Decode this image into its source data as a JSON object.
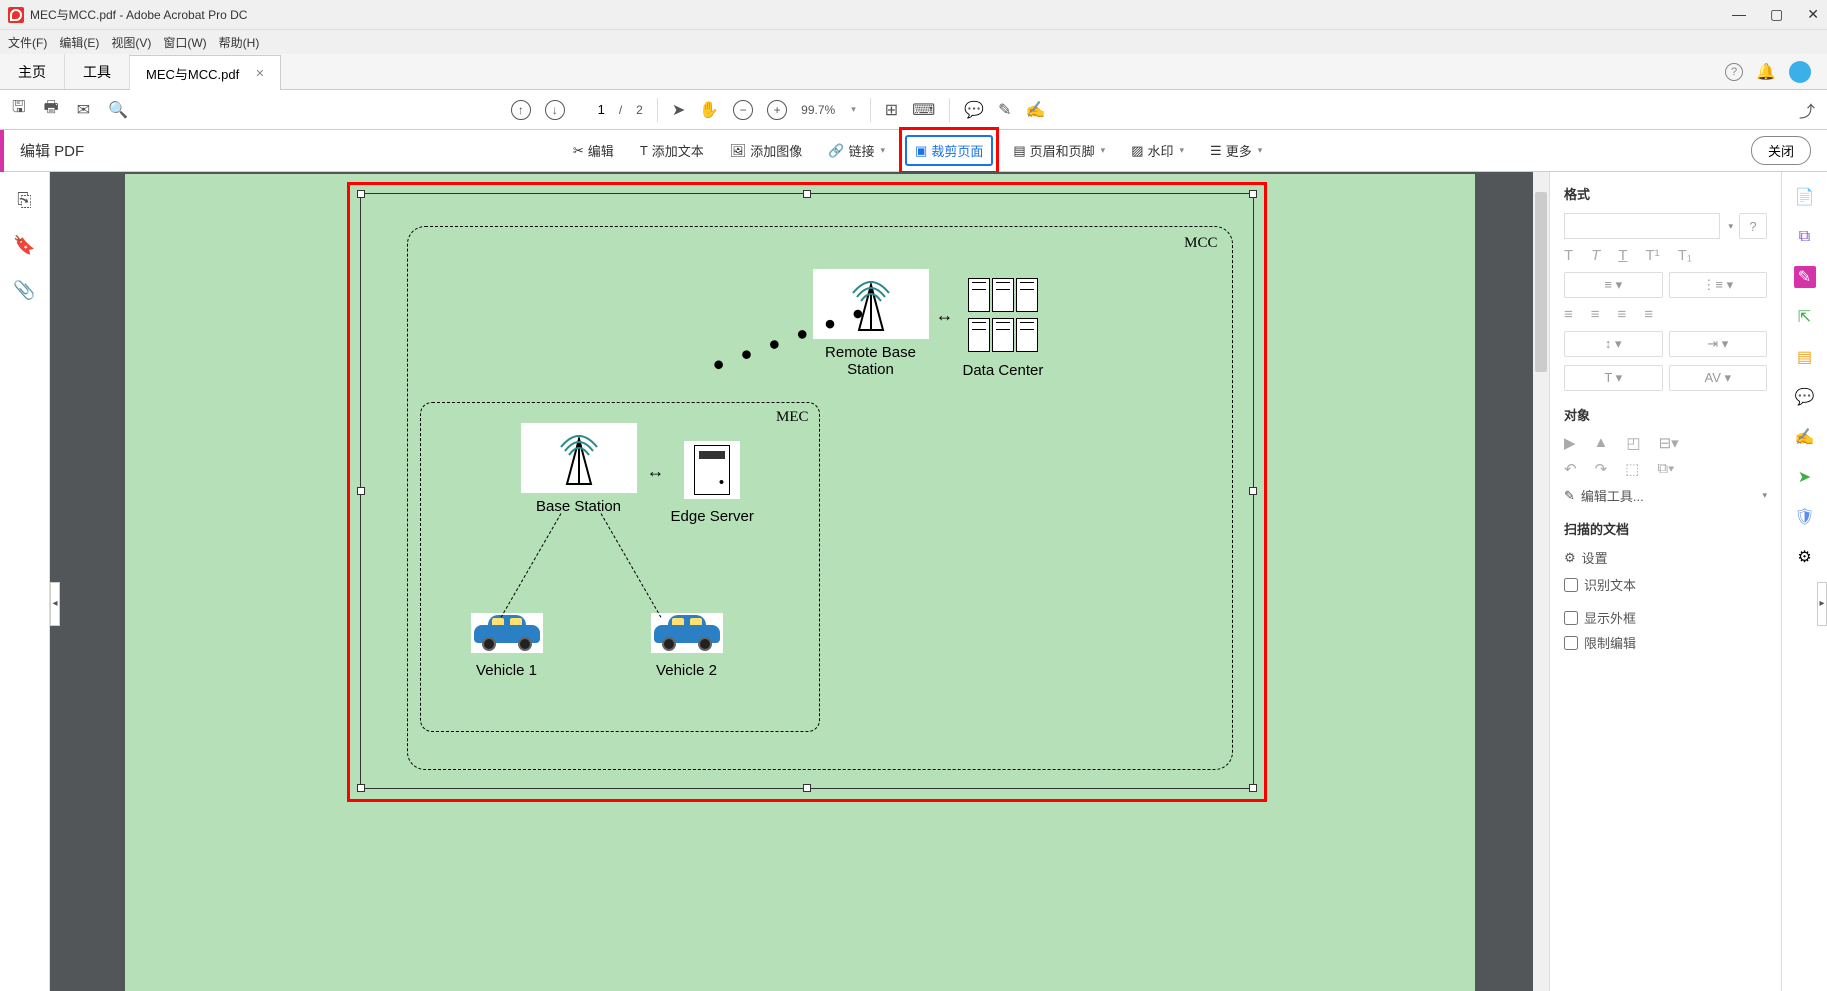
{
  "window": {
    "title": "MEC与MCC.pdf - Adobe Acrobat Pro DC"
  },
  "menu": {
    "file": "文件(F)",
    "edit": "编辑(E)",
    "view": "视图(V)",
    "window": "窗口(W)",
    "help": "帮助(H)"
  },
  "tabs": {
    "home": "主页",
    "tools": "工具",
    "active": "MEC与MCC.pdf"
  },
  "toolbar": {
    "page_current": "1",
    "page_sep": "/",
    "page_total": "2",
    "zoom": "99.7%"
  },
  "editbar": {
    "title": "编辑 PDF",
    "edit": "编辑",
    "add_text": "添加文本",
    "add_image": "添加图像",
    "link": "链接",
    "crop": "裁剪页面",
    "header": "页眉和页脚",
    "watermark": "水印",
    "more": "更多",
    "close": "关闭"
  },
  "diagram": {
    "mcc": "MCC",
    "mec": "MEC",
    "remote_bs_l1": "Remote Base",
    "remote_bs_l2": "Station",
    "data_center": "Data Center",
    "base_station": "Base Station",
    "edge_server": "Edge Server",
    "vehicle1": "Vehicle 1",
    "vehicle2": "Vehicle 2"
  },
  "rightpanel": {
    "format": "格式",
    "object": "对象",
    "edit_tool": "编辑工具...",
    "scanned": "扫描的文档",
    "settings": "设置",
    "ocr": "识别文本",
    "show_box": "显示外框",
    "restrict": "限制编辑"
  }
}
